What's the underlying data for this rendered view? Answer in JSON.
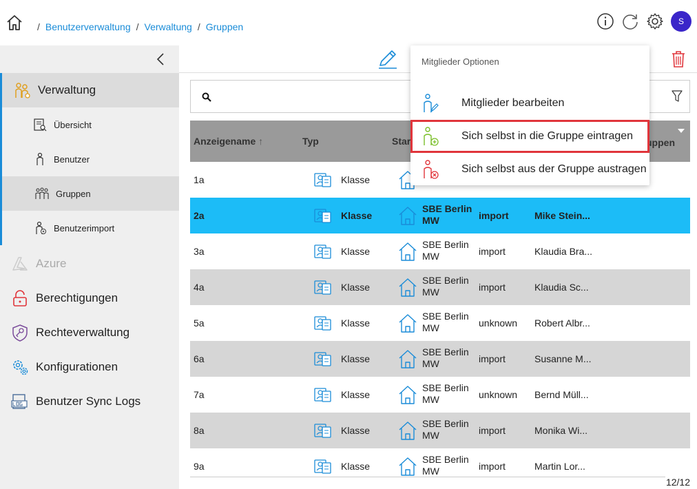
{
  "breadcrumb": {
    "items": [
      "Benutzerverwaltung",
      "Verwaltung",
      "Gruppen"
    ],
    "separator": "/"
  },
  "header": {
    "avatar_initial": "S",
    "icons": [
      "home-icon",
      "info-icon",
      "refresh-icon",
      "gear-icon"
    ]
  },
  "sidebar": {
    "sections": [
      {
        "label": "Verwaltung",
        "icon": "users-admin-icon"
      },
      {
        "label": "Azure",
        "icon": "azure-icon"
      },
      {
        "label": "Berechtigungen",
        "icon": "lock-icon"
      },
      {
        "label": "Rechteverwaltung",
        "icon": "shield-key-icon"
      },
      {
        "label": "Konfigurationen",
        "icon": "gears-icon"
      },
      {
        "label": "Benutzer Sync Logs",
        "icon": "log-icon"
      }
    ],
    "subitems": [
      {
        "label": "Übersicht",
        "icon": "overview-icon"
      },
      {
        "label": "Benutzer",
        "icon": "user-icon"
      },
      {
        "label": "Gruppen",
        "icon": "group-icon"
      },
      {
        "label": "Benutzerimport",
        "icon": "user-import-icon"
      }
    ]
  },
  "table": {
    "columns": [
      "Anzeigename",
      "Typ",
      "Star",
      "uppen"
    ],
    "rows": [
      {
        "name": "1a",
        "type": "Klasse",
        "location": "",
        "source": "",
        "user": ""
      },
      {
        "name": "2a",
        "type": "Klasse",
        "location": "SBE Berlin MW",
        "source": "import",
        "user": "Mike Stein..."
      },
      {
        "name": "3a",
        "type": "Klasse",
        "location": "SBE Berlin MW",
        "source": "import",
        "user": "Klaudia Bra..."
      },
      {
        "name": "4a",
        "type": "Klasse",
        "location": "SBE Berlin MW",
        "source": "import",
        "user": "Klaudia Sc..."
      },
      {
        "name": "5a",
        "type": "Klasse",
        "location": "SBE Berlin MW",
        "source": "unknown",
        "user": "Robert Albr..."
      },
      {
        "name": "6a",
        "type": "Klasse",
        "location": "SBE Berlin MW",
        "source": "import",
        "user": "Susanne M..."
      },
      {
        "name": "7a",
        "type": "Klasse",
        "location": "SBE Berlin MW",
        "source": "unknown",
        "user": "Bernd Müll..."
      },
      {
        "name": "8a",
        "type": "Klasse",
        "location": "SBE Berlin MW",
        "source": "import",
        "user": "Monika Wi..."
      },
      {
        "name": "9a",
        "type": "Klasse",
        "location": "SBE Berlin MW",
        "source": "import",
        "user": "Martin Lor..."
      }
    ],
    "selected_row": "2a",
    "pager": "12/12"
  },
  "menu": {
    "title": "Mitglieder Optionen",
    "items": [
      {
        "label": "Mitglieder bearbeiten",
        "icon": "edit-members-icon"
      },
      {
        "label": "Sich selbst in die Gruppe eintragen",
        "icon": "add-self-icon"
      },
      {
        "label": "Sich selbst aus der Gruppe austragen",
        "icon": "remove-self-icon"
      }
    ]
  },
  "colors": {
    "accent": "#1a8cd8",
    "selected_row": "#1cbcf7",
    "highlight_outline": "#e0353b",
    "avatar": "#3a25c9",
    "delete": "#e0353b"
  }
}
